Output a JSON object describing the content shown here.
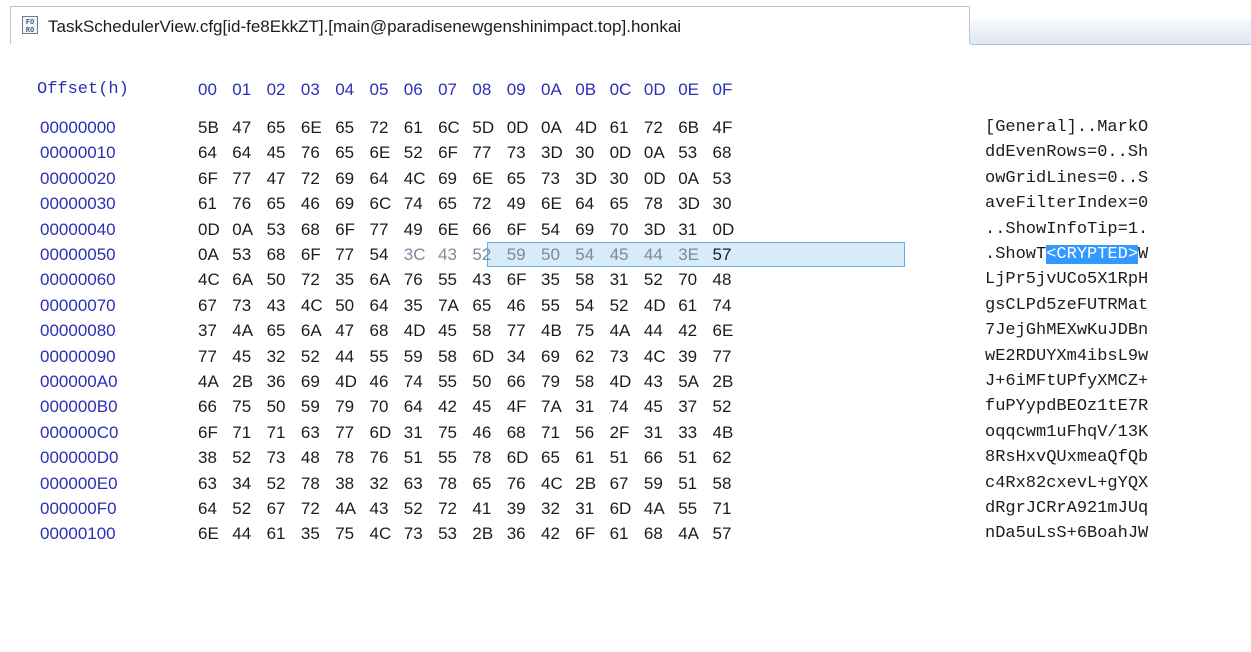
{
  "tab": {
    "title": "TaskSchedulerView.cfg[id-fe8EkkZT].[main@paradisenewgenshinimpact.top].honkai",
    "icon": "hex-file-icon"
  },
  "header": {
    "offset_label": "Offset(h)",
    "columns": [
      "00",
      "01",
      "02",
      "03",
      "04",
      "05",
      "06",
      "07",
      "08",
      "09",
      "0A",
      "0B",
      "0C",
      "0D",
      "0E",
      "0F"
    ]
  },
  "selection": {
    "row_index": 5,
    "start": 6,
    "end": 14,
    "text": "<CRYPTED>"
  },
  "rows": [
    {
      "offset": "00000000",
      "bytes": [
        "5B",
        "47",
        "65",
        "6E",
        "65",
        "72",
        "61",
        "6C",
        "5D",
        "0D",
        "0A",
        "4D",
        "61",
        "72",
        "6B",
        "4F"
      ],
      "ascii": "[General]..MarkO"
    },
    {
      "offset": "00000010",
      "bytes": [
        "64",
        "64",
        "45",
        "76",
        "65",
        "6E",
        "52",
        "6F",
        "77",
        "73",
        "3D",
        "30",
        "0D",
        "0A",
        "53",
        "68"
      ],
      "ascii": "ddEvenRows=0..Sh"
    },
    {
      "offset": "00000020",
      "bytes": [
        "6F",
        "77",
        "47",
        "72",
        "69",
        "64",
        "4C",
        "69",
        "6E",
        "65",
        "73",
        "3D",
        "30",
        "0D",
        "0A",
        "53"
      ],
      "ascii": "owGridLines=0..S"
    },
    {
      "offset": "00000030",
      "bytes": [
        "61",
        "76",
        "65",
        "46",
        "69",
        "6C",
        "74",
        "65",
        "72",
        "49",
        "6E",
        "64",
        "65",
        "78",
        "3D",
        "30"
      ],
      "ascii": "aveFilterIndex=0"
    },
    {
      "offset": "00000040",
      "bytes": [
        "0D",
        "0A",
        "53",
        "68",
        "6F",
        "77",
        "49",
        "6E",
        "66",
        "6F",
        "54",
        "69",
        "70",
        "3D",
        "31",
        "0D"
      ],
      "ascii": "..ShowInfoTip=1."
    },
    {
      "offset": "00000050",
      "bytes": [
        "0A",
        "53",
        "68",
        "6F",
        "77",
        "54",
        "3C",
        "43",
        "52",
        "59",
        "50",
        "54",
        "45",
        "44",
        "3E",
        "57"
      ],
      "ascii": ".ShowT<CRYPTED>W",
      "ascii_pre": ".ShowT",
      "ascii_sel": "<CRYPTED>",
      "ascii_post": "W"
    },
    {
      "offset": "00000060",
      "bytes": [
        "4C",
        "6A",
        "50",
        "72",
        "35",
        "6A",
        "76",
        "55",
        "43",
        "6F",
        "35",
        "58",
        "31",
        "52",
        "70",
        "48"
      ],
      "ascii": "LjPr5jvUCo5X1RpH"
    },
    {
      "offset": "00000070",
      "bytes": [
        "67",
        "73",
        "43",
        "4C",
        "50",
        "64",
        "35",
        "7A",
        "65",
        "46",
        "55",
        "54",
        "52",
        "4D",
        "61",
        "74"
      ],
      "ascii": "gsCLPd5zeFUTRMat"
    },
    {
      "offset": "00000080",
      "bytes": [
        "37",
        "4A",
        "65",
        "6A",
        "47",
        "68",
        "4D",
        "45",
        "58",
        "77",
        "4B",
        "75",
        "4A",
        "44",
        "42",
        "6E"
      ],
      "ascii": "7JejGhMEXwKuJDBn"
    },
    {
      "offset": "00000090",
      "bytes": [
        "77",
        "45",
        "32",
        "52",
        "44",
        "55",
        "59",
        "58",
        "6D",
        "34",
        "69",
        "62",
        "73",
        "4C",
        "39",
        "77"
      ],
      "ascii": "wE2RDUYXm4ibsL9w"
    },
    {
      "offset": "000000A0",
      "bytes": [
        "4A",
        "2B",
        "36",
        "69",
        "4D",
        "46",
        "74",
        "55",
        "50",
        "66",
        "79",
        "58",
        "4D",
        "43",
        "5A",
        "2B"
      ],
      "ascii": "J+6iMFtUPfyXMCZ+"
    },
    {
      "offset": "000000B0",
      "bytes": [
        "66",
        "75",
        "50",
        "59",
        "79",
        "70",
        "64",
        "42",
        "45",
        "4F",
        "7A",
        "31",
        "74",
        "45",
        "37",
        "52"
      ],
      "ascii": "fuPYypdBEOz1tE7R"
    },
    {
      "offset": "000000C0",
      "bytes": [
        "6F",
        "71",
        "71",
        "63",
        "77",
        "6D",
        "31",
        "75",
        "46",
        "68",
        "71",
        "56",
        "2F",
        "31",
        "33",
        "4B"
      ],
      "ascii": "oqqcwm1uFhqV/13K"
    },
    {
      "offset": "000000D0",
      "bytes": [
        "38",
        "52",
        "73",
        "48",
        "78",
        "76",
        "51",
        "55",
        "78",
        "6D",
        "65",
        "61",
        "51",
        "66",
        "51",
        "62"
      ],
      "ascii": "8RsHxvQUxmeaQfQb"
    },
    {
      "offset": "000000E0",
      "bytes": [
        "63",
        "34",
        "52",
        "78",
        "38",
        "32",
        "63",
        "78",
        "65",
        "76",
        "4C",
        "2B",
        "67",
        "59",
        "51",
        "58"
      ],
      "ascii": "c4Rx82cxevL+gYQX"
    },
    {
      "offset": "000000F0",
      "bytes": [
        "64",
        "52",
        "67",
        "72",
        "4A",
        "43",
        "52",
        "72",
        "41",
        "39",
        "32",
        "31",
        "6D",
        "4A",
        "55",
        "71"
      ],
      "ascii": "dRgrJCRrA921mJUq"
    },
    {
      "offset": "00000100",
      "bytes": [
        "6E",
        "44",
        "61",
        "35",
        "75",
        "4C",
        "73",
        "53",
        "2B",
        "36",
        "42",
        "6F",
        "61",
        "68",
        "4A",
        "57"
      ],
      "ascii": "nDa5uLsS+6BoahJW"
    }
  ]
}
